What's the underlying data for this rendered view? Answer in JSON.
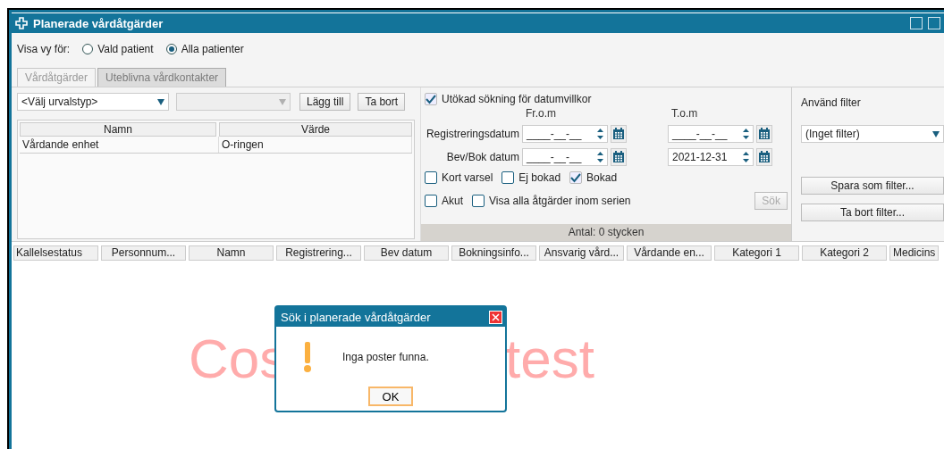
{
  "window": {
    "title": "Planerade vårdåtgärder"
  },
  "view_for": {
    "label": "Visa vy för:",
    "options": [
      {
        "label": "Vald patient",
        "selected": false
      },
      {
        "label": "Alla patienter",
        "selected": true
      }
    ]
  },
  "tabs": [
    {
      "label": "Vårdåtgärder",
      "selected": true
    },
    {
      "label": "Uteblivna vårdkontakter",
      "selected": false
    }
  ],
  "criteria": {
    "type_select": "<Välj urvalstyp>",
    "add_button": "Lägg till",
    "remove_button": "Ta bort",
    "columns": [
      "Namn",
      "Värde"
    ],
    "rows": [
      [
        "Vårdande enhet",
        "O-ringen"
      ]
    ]
  },
  "date_search": {
    "extended": {
      "label": "Utökad sökning för datumvillkor",
      "checked": true
    },
    "from_label": "Fr.o.m",
    "to_label": "T.o.m",
    "rows": [
      {
        "label": "Registreringsdatum",
        "from": "____-__-__",
        "to": "____-__-__"
      },
      {
        "label": "Bev/Bok datum",
        "from": "____-__-__",
        "to": "2021-12-31"
      }
    ],
    "checkbox_rows": [
      [
        {
          "label": "Kort varsel",
          "checked": false
        },
        {
          "label": "Ej bokad",
          "checked": false
        },
        {
          "label": "Bokad",
          "checked": true
        }
      ],
      [
        {
          "label": "Akut",
          "checked": false
        },
        {
          "label": "Visa alla åtgärder inom serien",
          "checked": false
        }
      ]
    ],
    "search_button": {
      "label": "Sök",
      "disabled": true
    },
    "count": "Antal: 0 stycken"
  },
  "filter": {
    "label": "Använd filter",
    "select": "(Inget filter)",
    "save_button": "Spara som filter...",
    "delete_button": "Ta bort filter..."
  },
  "results": {
    "columns": [
      "Kallelsestatus",
      "Personnum...",
      "Namn",
      "Registrering...",
      "Bev datum",
      "Bokningsinfo...",
      "Ansvarig vård...",
      "Vårdande en...",
      "Kategori 1",
      "Kategori 2",
      "Medicins"
    ],
    "background_text": [
      "Cos",
      "test"
    ]
  },
  "dialog": {
    "title": "Sök i planerade vårdåtgärder",
    "message": "Inga poster funna.",
    "ok_button": "OK"
  }
}
